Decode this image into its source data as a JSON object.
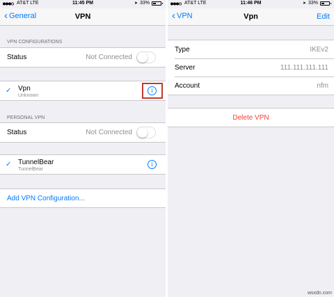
{
  "left": {
    "status_bar": {
      "carrier": "AT&T",
      "network": "LTE",
      "time": "11:45 PM",
      "battery": "33%"
    },
    "nav": {
      "back_label": "General",
      "title": "VPN"
    },
    "vpn_section_header": "VPN CONFIGURATIONS",
    "vpn_status": {
      "label": "Status",
      "value": "Not Connected",
      "on": false
    },
    "vpn_item": {
      "name": "Vpn",
      "subtitle": "Unknown"
    },
    "personal_section_header": "PERSONAL VPN",
    "personal_status": {
      "label": "Status",
      "value": "Not Connected",
      "on": false
    },
    "personal_item": {
      "name": "TunnelBear",
      "subtitle": "TunnelBear"
    },
    "add_link": "Add VPN Configuration..."
  },
  "right": {
    "status_bar": {
      "carrier": "AT&T",
      "network": "LTE",
      "time": "11:46 PM",
      "battery": "33%"
    },
    "nav": {
      "back_label": "VPN",
      "title": "Vpn",
      "action_label": "Edit"
    },
    "details": [
      {
        "label": "Type",
        "value": "IKEv2"
      },
      {
        "label": "Server",
        "value": "111.111.111.111"
      },
      {
        "label": "Account",
        "value": "nfm"
      }
    ],
    "delete_label": "Delete VPN"
  },
  "watermark": "wsxdn.com",
  "colors": {
    "accent": "#007aff",
    "destructive": "#ff3b30",
    "highlight": "#c0392b"
  }
}
